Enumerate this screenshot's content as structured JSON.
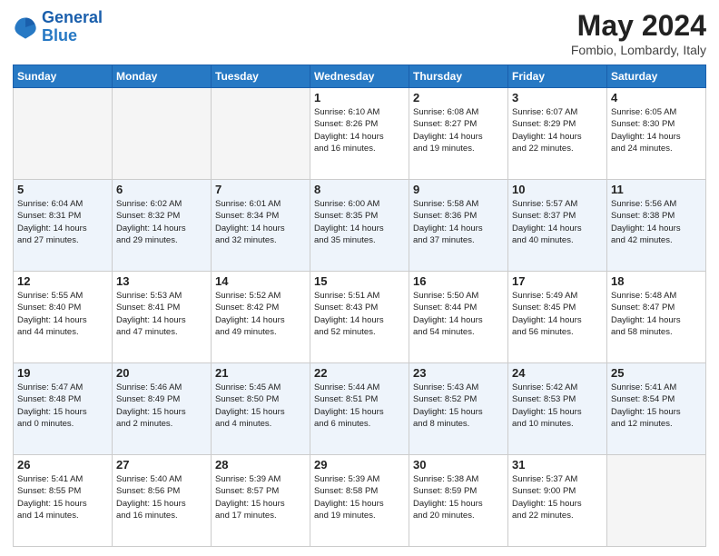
{
  "header": {
    "logo_line1": "General",
    "logo_line2": "Blue",
    "month": "May 2024",
    "location": "Fombio, Lombardy, Italy"
  },
  "weekdays": [
    "Sunday",
    "Monday",
    "Tuesday",
    "Wednesday",
    "Thursday",
    "Friday",
    "Saturday"
  ],
  "weeks": [
    [
      {
        "day": "",
        "info": ""
      },
      {
        "day": "",
        "info": ""
      },
      {
        "day": "",
        "info": ""
      },
      {
        "day": "1",
        "info": "Sunrise: 6:10 AM\nSunset: 8:26 PM\nDaylight: 14 hours\nand 16 minutes."
      },
      {
        "day": "2",
        "info": "Sunrise: 6:08 AM\nSunset: 8:27 PM\nDaylight: 14 hours\nand 19 minutes."
      },
      {
        "day": "3",
        "info": "Sunrise: 6:07 AM\nSunset: 8:29 PM\nDaylight: 14 hours\nand 22 minutes."
      },
      {
        "day": "4",
        "info": "Sunrise: 6:05 AM\nSunset: 8:30 PM\nDaylight: 14 hours\nand 24 minutes."
      }
    ],
    [
      {
        "day": "5",
        "info": "Sunrise: 6:04 AM\nSunset: 8:31 PM\nDaylight: 14 hours\nand 27 minutes."
      },
      {
        "day": "6",
        "info": "Sunrise: 6:02 AM\nSunset: 8:32 PM\nDaylight: 14 hours\nand 29 minutes."
      },
      {
        "day": "7",
        "info": "Sunrise: 6:01 AM\nSunset: 8:34 PM\nDaylight: 14 hours\nand 32 minutes."
      },
      {
        "day": "8",
        "info": "Sunrise: 6:00 AM\nSunset: 8:35 PM\nDaylight: 14 hours\nand 35 minutes."
      },
      {
        "day": "9",
        "info": "Sunrise: 5:58 AM\nSunset: 8:36 PM\nDaylight: 14 hours\nand 37 minutes."
      },
      {
        "day": "10",
        "info": "Sunrise: 5:57 AM\nSunset: 8:37 PM\nDaylight: 14 hours\nand 40 minutes."
      },
      {
        "day": "11",
        "info": "Sunrise: 5:56 AM\nSunset: 8:38 PM\nDaylight: 14 hours\nand 42 minutes."
      }
    ],
    [
      {
        "day": "12",
        "info": "Sunrise: 5:55 AM\nSunset: 8:40 PM\nDaylight: 14 hours\nand 44 minutes."
      },
      {
        "day": "13",
        "info": "Sunrise: 5:53 AM\nSunset: 8:41 PM\nDaylight: 14 hours\nand 47 minutes."
      },
      {
        "day": "14",
        "info": "Sunrise: 5:52 AM\nSunset: 8:42 PM\nDaylight: 14 hours\nand 49 minutes."
      },
      {
        "day": "15",
        "info": "Sunrise: 5:51 AM\nSunset: 8:43 PM\nDaylight: 14 hours\nand 52 minutes."
      },
      {
        "day": "16",
        "info": "Sunrise: 5:50 AM\nSunset: 8:44 PM\nDaylight: 14 hours\nand 54 minutes."
      },
      {
        "day": "17",
        "info": "Sunrise: 5:49 AM\nSunset: 8:45 PM\nDaylight: 14 hours\nand 56 minutes."
      },
      {
        "day": "18",
        "info": "Sunrise: 5:48 AM\nSunset: 8:47 PM\nDaylight: 14 hours\nand 58 minutes."
      }
    ],
    [
      {
        "day": "19",
        "info": "Sunrise: 5:47 AM\nSunset: 8:48 PM\nDaylight: 15 hours\nand 0 minutes."
      },
      {
        "day": "20",
        "info": "Sunrise: 5:46 AM\nSunset: 8:49 PM\nDaylight: 15 hours\nand 2 minutes."
      },
      {
        "day": "21",
        "info": "Sunrise: 5:45 AM\nSunset: 8:50 PM\nDaylight: 15 hours\nand 4 minutes."
      },
      {
        "day": "22",
        "info": "Sunrise: 5:44 AM\nSunset: 8:51 PM\nDaylight: 15 hours\nand 6 minutes."
      },
      {
        "day": "23",
        "info": "Sunrise: 5:43 AM\nSunset: 8:52 PM\nDaylight: 15 hours\nand 8 minutes."
      },
      {
        "day": "24",
        "info": "Sunrise: 5:42 AM\nSunset: 8:53 PM\nDaylight: 15 hours\nand 10 minutes."
      },
      {
        "day": "25",
        "info": "Sunrise: 5:41 AM\nSunset: 8:54 PM\nDaylight: 15 hours\nand 12 minutes."
      }
    ],
    [
      {
        "day": "26",
        "info": "Sunrise: 5:41 AM\nSunset: 8:55 PM\nDaylight: 15 hours\nand 14 minutes."
      },
      {
        "day": "27",
        "info": "Sunrise: 5:40 AM\nSunset: 8:56 PM\nDaylight: 15 hours\nand 16 minutes."
      },
      {
        "day": "28",
        "info": "Sunrise: 5:39 AM\nSunset: 8:57 PM\nDaylight: 15 hours\nand 17 minutes."
      },
      {
        "day": "29",
        "info": "Sunrise: 5:39 AM\nSunset: 8:58 PM\nDaylight: 15 hours\nand 19 minutes."
      },
      {
        "day": "30",
        "info": "Sunrise: 5:38 AM\nSunset: 8:59 PM\nDaylight: 15 hours\nand 20 minutes."
      },
      {
        "day": "31",
        "info": "Sunrise: 5:37 AM\nSunset: 9:00 PM\nDaylight: 15 hours\nand 22 minutes."
      },
      {
        "day": "",
        "info": ""
      }
    ]
  ]
}
